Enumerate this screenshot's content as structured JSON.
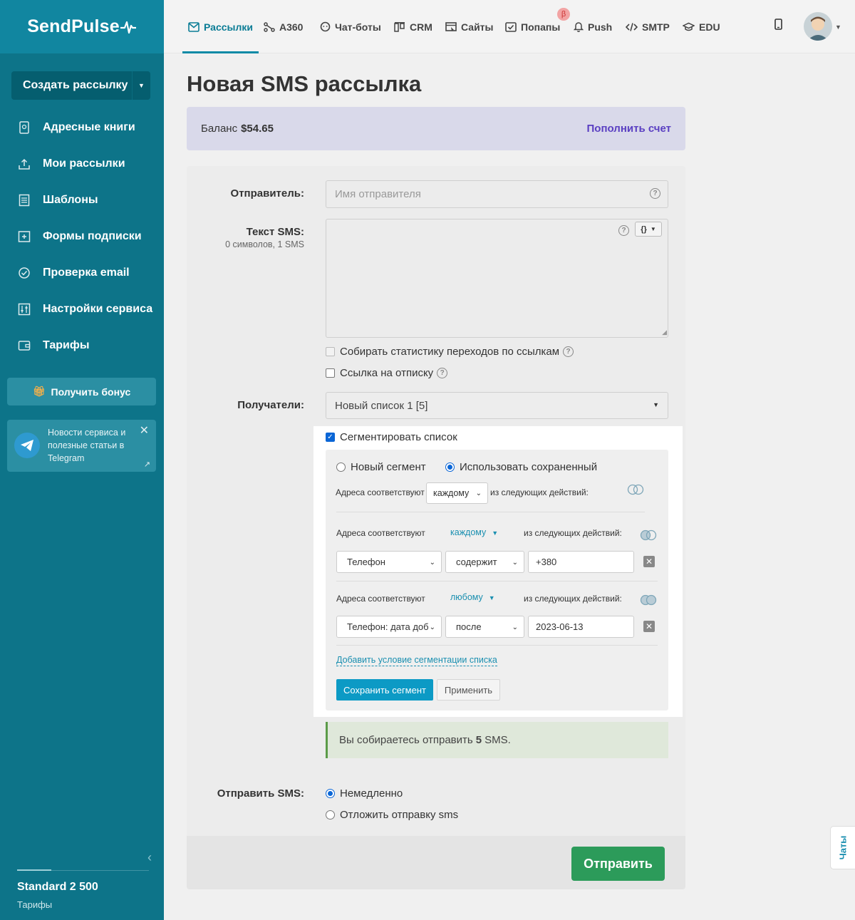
{
  "brand": {
    "logo": "SendPulse",
    "logo_mark": "pulse-wave-icon"
  },
  "sidebar": {
    "create_button": "Создать рассылку",
    "items": [
      {
        "label": "Адресные книги",
        "icon": "address-book-icon"
      },
      {
        "label": "Мои рассылки",
        "icon": "campaigns-icon"
      },
      {
        "label": "Шаблоны",
        "icon": "templates-icon"
      },
      {
        "label": "Формы подписки",
        "icon": "forms-icon"
      },
      {
        "label": "Проверка email",
        "icon": "email-check-icon"
      },
      {
        "label": "Настройки сервиса",
        "icon": "settings-sliders-icon"
      },
      {
        "label": "Тарифы",
        "icon": "wallet-icon"
      }
    ],
    "bonus_button": "Получить бонус",
    "telegram_card": {
      "text": "Новости сервиса и полезные статьи в Telegram"
    },
    "plan": {
      "name": "Standard 2 500",
      "link": "Тарифы"
    }
  },
  "topnav": {
    "tabs": [
      {
        "label": "Рассылки",
        "icon": "envelope-icon",
        "active": true
      },
      {
        "label": "A360",
        "icon": "flow-icon"
      },
      {
        "label": "Чат-боты",
        "icon": "chatbot-icon"
      },
      {
        "label": "CRM",
        "icon": "crm-icon"
      },
      {
        "label": "Сайты",
        "icon": "site-icon"
      },
      {
        "label": "Попапы",
        "icon": "popup-icon"
      },
      {
        "label": "Push",
        "icon": "bell-icon"
      },
      {
        "label": "SMTP",
        "icon": "code-icon"
      },
      {
        "label": "EDU",
        "icon": "graduation-cap-icon"
      }
    ],
    "beta_badge": "β"
  },
  "page": {
    "title": "Новая SMS рассылка",
    "balance_label": "Баланс",
    "balance_amount": "$54.65",
    "topup_link": "Пополнить счет"
  },
  "form": {
    "sender_label": "Отправитель:",
    "sender_placeholder": "Имя отправителя",
    "sms_text_label": "Текст SMS:",
    "sms_text_counter": "0 символов, 1 SMS",
    "var_button": "{}",
    "track_links_label": "Собирать статистику переходов по ссылкам",
    "unsubscribe_link_label": "Ссылка на отписку",
    "recipients_label": "Получатели:",
    "recipients_value": "Новый список 1 [5]",
    "segment_checkbox": "Сегментировать список",
    "segment": {
      "new_segment": "Новый сегмент",
      "use_saved": "Использовать сохраненный",
      "top_rule_prefix": "Адреса соответствуют",
      "top_rule_select": "каждому",
      "top_rule_suffix": "из следующих действий:",
      "groups": [
        {
          "prefix": "Адреса соответствуют",
          "match": "каждому",
          "suffix": "из следующих действий:",
          "field": "Телефон",
          "operator": "содержит",
          "value": "+380"
        },
        {
          "prefix": "Адреса соответствуют",
          "match": "любому",
          "suffix": "из следующих действий:",
          "field": "Телефон: дата доб",
          "operator": "после",
          "value": "2023-06-13"
        }
      ],
      "add_condition": "Добавить условие сегментации списка",
      "save_button": "Сохранить сегмент",
      "apply_button": "Применить"
    },
    "notice_prefix": "Вы собираетесь отправить",
    "notice_count": "5",
    "notice_suffix": "SMS.",
    "send_label": "Отправить SMS:",
    "send_now": "Немедленно",
    "send_later": "Отложить отправку sms",
    "submit": "Отправить"
  },
  "chats_tab": "Чаты",
  "colors": {
    "sidebar": "#0d7489",
    "accent": "#0a7c95",
    "submit": "#2c9b5a",
    "link": "#5a3fc2"
  }
}
